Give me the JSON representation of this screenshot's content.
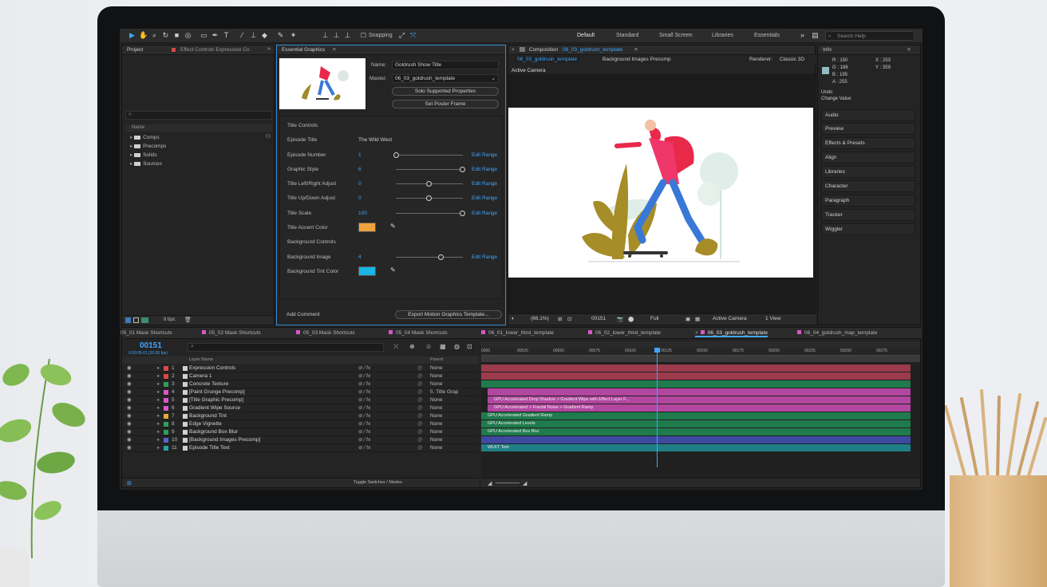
{
  "toolbar": {
    "snapping_label": "Snapping",
    "workspaces": [
      "Default",
      "Standard",
      "Small Screen",
      "Libraries",
      "Essentials"
    ],
    "search_placeholder": "Search Help"
  },
  "project_panel": {
    "tab_project": "Project",
    "tab_effect_controls": "Effect Controls Expression Co",
    "column_name": "Name",
    "items": [
      "Comps",
      "Precomps",
      "Solids",
      "Sources"
    ],
    "bpc": "8 bpc"
  },
  "essential_graphics": {
    "tab": "Essential Graphics",
    "name_label": "Name:",
    "name_value": "Goldrush Show Title",
    "master_label": "Master:",
    "master_value": "06_03_goldrush_template",
    "solo_button": "Solo Supported Properties",
    "poster_button": "Set Poster Frame",
    "rows": [
      {
        "label": "Title Controls",
        "value": "",
        "slider": null,
        "range": ""
      },
      {
        "label": "Episode Title",
        "value": "The Wild West",
        "slider": null,
        "range": ""
      },
      {
        "label": "Episode Number",
        "value": "1",
        "slider": 0.0,
        "range": "Edit Range"
      },
      {
        "label": "Graphic Style",
        "value": "6",
        "slider": 1.0,
        "range": "Edit Range"
      },
      {
        "label": "Title Left/Right Adjust",
        "value": "0",
        "slider": 0.5,
        "range": "Edit Range"
      },
      {
        "label": "Title Up/Down Adjust",
        "value": "0",
        "slider": 0.5,
        "range": "Edit Range"
      },
      {
        "label": "Title Scale",
        "value": "100",
        "slider": 1.0,
        "range": "Edit Range"
      },
      {
        "label": "Title Accent Color",
        "value": "",
        "slider": null,
        "range": ""
      },
      {
        "label": "Background Controls",
        "value": "",
        "slider": null,
        "range": ""
      },
      {
        "label": "Background Image",
        "value": "4",
        "slider": 0.66,
        "range": "Edit Range"
      },
      {
        "label": "Background Tint Color",
        "value": "",
        "slider": null,
        "range": ""
      }
    ],
    "accent_color": "#f0a23c",
    "tint_color": "#19b6e6",
    "add_comment": "Add Comment",
    "export_button": "Export Motion Graphics Template..."
  },
  "composition": {
    "title": "Composition",
    "comp_name": "06_03_goldrush_template",
    "tab_active": "06_03_goldrush_template",
    "tab_other": "Background Images Precomp",
    "renderer_label": "Renderer:",
    "renderer_value": "Classic 3D",
    "camera_label": "Active Camera",
    "zoom": "(66.1%)",
    "timecode": "00151",
    "resolution": "Full",
    "view_camera": "Active Camera",
    "view_count": "1 View"
  },
  "info_panel": {
    "tab": "Info",
    "r": "R : 150",
    "g": "G : 186",
    "b": "B : 195",
    "a": "A : 255",
    "x": "X : 253",
    "y": "Y : 359",
    "undo_line1": "Undo",
    "undo_line2": "Change Value",
    "panels": [
      "Audio",
      "Preview",
      "Effects & Presets",
      "Align",
      "Libraries",
      "Character",
      "Paragraph",
      "Tracker",
      "Wiggler"
    ],
    "swatch_color": "#96bac3"
  },
  "timeline": {
    "tabs": [
      "05_01 Mask Shortcuts",
      "05_02 Mask Shortcuts",
      "05_03 Mask Shortcuts",
      "05_04 Mask Shortcuts",
      "06_01_lower_third_template",
      "06_02_lower_third_template",
      "06_03_goldrush_template",
      "06_04_goldrush_map_template"
    ],
    "active_tab": "06_03_goldrush_template",
    "timecode": "00151",
    "timecode_sub": "0:00:05:01 (30.00 fps)",
    "column_source": "Layer Name",
    "column_parent": "Parent",
    "ruler": [
      "0000",
      "00025",
      "00050",
      "00075",
      "00100",
      "00125",
      "00150",
      "00175",
      "00200",
      "00225",
      "00250",
      "00275"
    ],
    "layers": [
      {
        "num": "1",
        "name": "Expression Controls",
        "label": "#d64a4a",
        "parent": "None"
      },
      {
        "num": "2",
        "name": "Camera 1",
        "label": "#d64a4a",
        "parent": "None"
      },
      {
        "num": "3",
        "name": "Concrete Texture",
        "label": "#2f9e5a",
        "parent": "None"
      },
      {
        "num": "4",
        "name": "[Paint Grunge Precomp]",
        "label": "#d957c6",
        "parent": "5. Title Grap"
      },
      {
        "num": "5",
        "name": "[Title Graphic Precomp]",
        "label": "#d957c6",
        "parent": "None"
      },
      {
        "num": "6",
        "name": "Gradient Wipe Source",
        "label": "#d957c6",
        "parent": "None"
      },
      {
        "num": "7",
        "name": "Background Tint",
        "label": "#e6a93a",
        "parent": "None"
      },
      {
        "num": "8",
        "name": "Edge Vignette",
        "label": "#2f9e5a",
        "parent": "None"
      },
      {
        "num": "9",
        "name": "Background Box Blur",
        "label": "#2f9e5a",
        "parent": "None"
      },
      {
        "num": "10",
        "name": "[Background Images Precomp]",
        "label": "#5566cc",
        "parent": "None"
      },
      {
        "num": "11",
        "name": "Episode Title Text",
        "label": "#2aa0a8",
        "parent": "None"
      }
    ],
    "bars": [
      {
        "color": "#9b3b4c",
        "label": ""
      },
      {
        "color": "#9b3b4c",
        "label": ""
      },
      {
        "color": "#1f7a4c",
        "label": ""
      },
      {
        "color": "#b2479f",
        "label": ""
      },
      {
        "color": "#b2479f",
        "label": "GPU Accelerated Drop Shadow > Gradient Wipe with Effect Layer F..."
      },
      {
        "color": "#b2479f",
        "label": "GPU Accelerated > Fractal Noise > Gradient Ramp"
      },
      {
        "color": "#1f7a4c",
        "label": "GPU Accelerated Gradient Ramp"
      },
      {
        "color": "#1f7a4c",
        "label": "GPU Accelerated Levels"
      },
      {
        "color": "#1f7a4c",
        "label": "GPU Accelerated Box Blur"
      },
      {
        "color": "#3d4aa0",
        "label": ""
      },
      {
        "color": "#1f7f86",
        "label": "WLKT Text"
      }
    ],
    "toggle_label": "Toggle Switches / Modes",
    "playhead": 0.4
  }
}
